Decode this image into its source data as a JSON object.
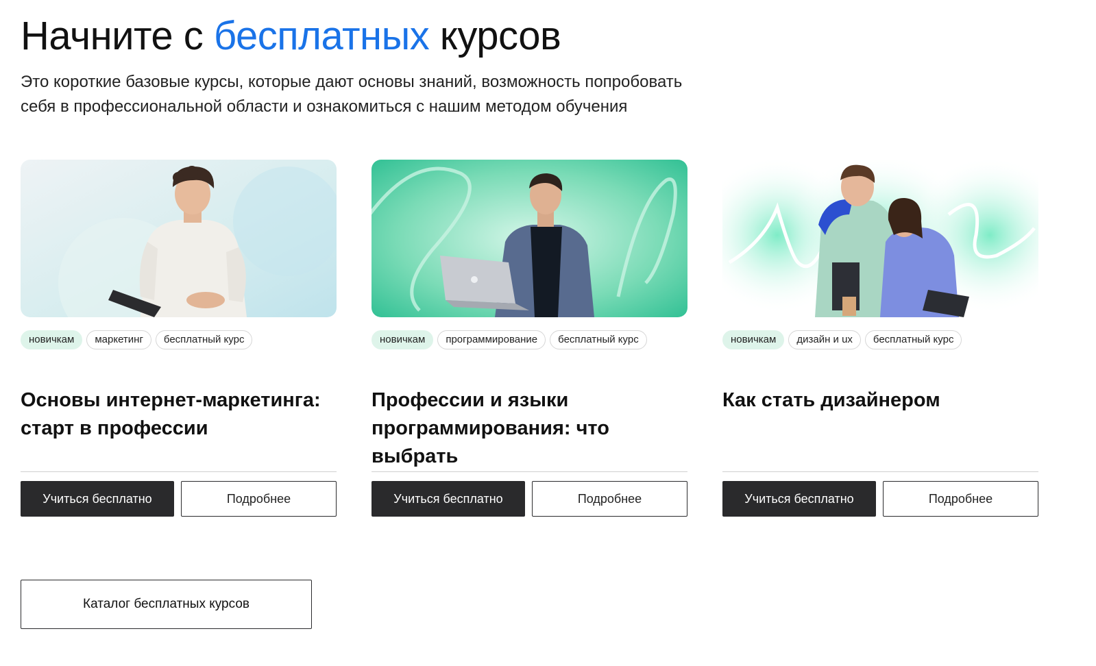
{
  "header": {
    "title_start": "Начните с",
    "title_accent": "бесплатных",
    "title_end": "курсов",
    "accent_color": "#1a73e8",
    "subtitle_line1": "Это короткие базовые курсы, которые дают основы знаний, возможность попробовать",
    "subtitle_line2": "себя в профессиональной области и ознакомиться с нашим методом обучения"
  },
  "cards": [
    {
      "image": "person-with-laptop-photo",
      "tags": [
        "новичкам",
        "маркетинг",
        "бесплатный курс"
      ],
      "title": "Основы интернет-маркетинга: старт в профессии",
      "primary_label": "Учиться бесплатно",
      "secondary_label": "Подробнее"
    },
    {
      "image": "man-with-laptop-photo",
      "tags": [
        "новичкам",
        "программирование",
        "бесплатный курс"
      ],
      "title": "Профессии и языки программирования: что выбрать",
      "primary_label": "Учиться бесплатно",
      "secondary_label": "Подробнее"
    },
    {
      "image": "two-people-with-tablet-photo",
      "tags": [
        "новичкам",
        "дизайн и ux",
        "бесплатный курс"
      ],
      "title": "Как стать дизайнером",
      "primary_label": "Учиться бесплатно",
      "secondary_label": "Подробнее"
    }
  ],
  "catalog_label": "Каталог бесплатных курсов",
  "colors": {
    "primary_button": "#2a2a2c",
    "tag_highlight": "#def4ea",
    "card1_bg": "#d8ecef",
    "card2_bg": "#3cc49a",
    "card3_bg": "#8ff0cf"
  }
}
